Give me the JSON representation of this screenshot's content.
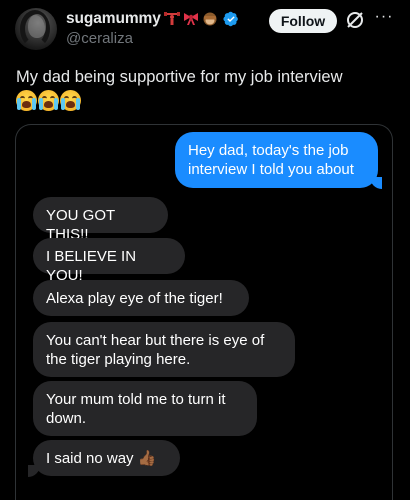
{
  "tweet": {
    "display_name": "sugamummy",
    "name_emojis": [
      "🏋",
      "🎀",
      "🙈"
    ],
    "handle": "@ceraliza",
    "follow_label": "Follow",
    "more_label": "···",
    "text": "My dad being supportive for my job interview",
    "text_emojis": [
      "😭",
      "😭",
      "😭"
    ]
  },
  "colors": {
    "accent": "#1d9bf0",
    "sent_bubble": "#1a8cff",
    "received_bubble": "#262628"
  },
  "chat": {
    "sent": {
      "line1": "Hey dad, today's the job",
      "line2": "interview I told you about"
    },
    "received": [
      {
        "line1": "YOU GOT THIS!!",
        "line2": ""
      },
      {
        "line1": "I BELIEVE IN YOU!",
        "line2": ""
      },
      {
        "line1": "Alexa play eye of the tiger!",
        "line2": ""
      },
      {
        "line1": "You can't hear but there is eye of",
        "line2": "the tiger playing here."
      },
      {
        "line1": "Your mum told me to turn it",
        "line2": "down."
      },
      {
        "line1": "I said no way",
        "line2": ""
      }
    ],
    "last_emoji": "👍🏾"
  }
}
